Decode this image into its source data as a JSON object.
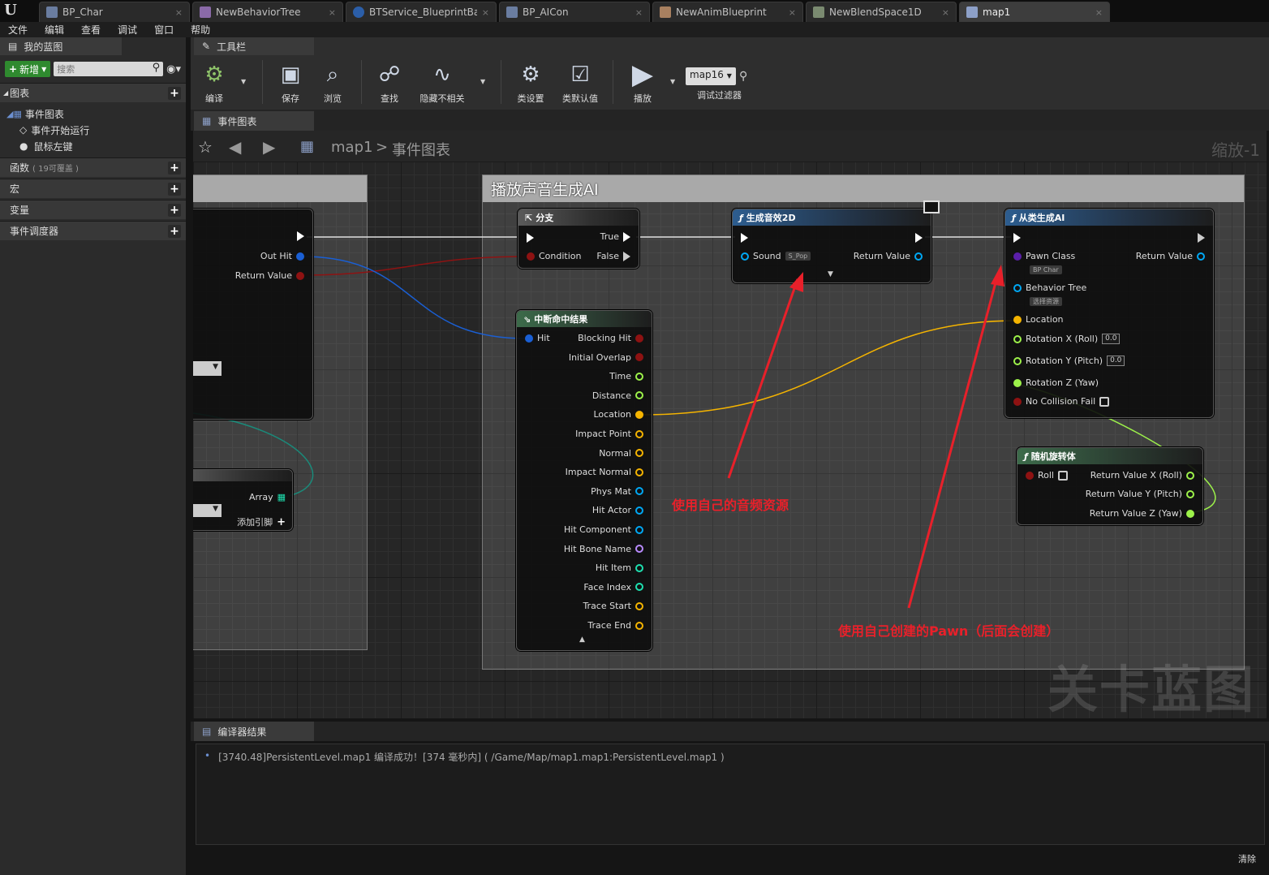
{
  "tabs": [
    {
      "label": "BP_Char",
      "active": false
    },
    {
      "label": "NewBehaviorTree",
      "active": false
    },
    {
      "label": "BTService_BlueprintBase_",
      "active": false
    },
    {
      "label": "BP_AICon",
      "active": false
    },
    {
      "label": "NewAnimBlueprint",
      "active": false
    },
    {
      "label": "NewBlendSpace1D",
      "active": false
    },
    {
      "label": "map1",
      "active": true
    }
  ],
  "menu": [
    "文件",
    "编辑",
    "查看",
    "调试",
    "窗口",
    "帮助"
  ],
  "left": {
    "title": "我的蓝图",
    "add_label": "新增",
    "search_placeholder": "搜索",
    "graphs_label": "图表",
    "event_graph": "事件图表",
    "event_begin": "事件开始运行",
    "mouse_left": "鼠标左键",
    "functions_label": "函数",
    "functions_sub": "( 19可覆盖 )",
    "macros_label": "宏",
    "variables_label": "变量",
    "dispatchers_label": "事件调度器"
  },
  "toolbar": {
    "title": "工具栏",
    "compile": "编译",
    "save": "保存",
    "browse": "浏览",
    "find": "查找",
    "hide_unrelated": "隐藏不相关",
    "class_settings": "类设置",
    "class_defaults": "类默认值",
    "play": "播放",
    "debug_select": "map16",
    "debug_filter": "调试过滤器"
  },
  "graph_tab": "事件图表",
  "breadcrumb": {
    "root": "map1",
    "sep": ">",
    "current": "事件图表",
    "zoom": "缩放-1"
  },
  "comment_title": "播放声音生成AI",
  "watermark": "关卡蓝图",
  "nodes": {
    "left": {
      "out_hit": "Out Hit",
      "return_value": "Return Value",
      "array": "Array",
      "add_pin": "添加引脚"
    },
    "branch": {
      "title": "分支",
      "true": "True",
      "condition": "Condition",
      "false": "False"
    },
    "sound": {
      "title": "生成音效2D",
      "sound": "Sound",
      "sound_val": "S_Pop",
      "return": "Return Value"
    },
    "break_hit": {
      "title": "中断命中结果",
      "hit": "Hit",
      "pins": [
        "Blocking Hit",
        "Initial Overlap",
        "Time",
        "Distance",
        "Location",
        "Impact Point",
        "Normal",
        "Impact Normal",
        "Phys Mat",
        "Hit Actor",
        "Hit Component",
        "Hit Bone Name",
        "Hit Item",
        "Face Index",
        "Trace Start",
        "Trace End"
      ]
    },
    "spawn_ai": {
      "title": "从类生成AI",
      "pawn_class": "Pawn Class",
      "pawn_val": "BP Char",
      "return": "Return Value",
      "behavior_tree": "Behavior Tree",
      "bt_val": "选择资源",
      "location": "Location",
      "rot_x": "Rotation X (Roll)",
      "rot_y": "Rotation Y (Pitch)",
      "rot_z": "Rotation Z (Yaw)",
      "rot_x_val": "0.0",
      "rot_y_val": "0.0",
      "no_collision": "No Collision Fail"
    },
    "random_rot": {
      "title": "随机旋转体",
      "roll": "Roll",
      "rx": "Return Value X (Roll)",
      "ry": "Return Value Y (Pitch)",
      "rz": "Return Value Z (Yaw)"
    }
  },
  "annotations": {
    "sound_note": "使用自己的音频资源",
    "pawn_note": "使用自己创建的Pawn（后面会创建）"
  },
  "compiler": {
    "tab": "编译器结果",
    "log": "[3740.48]PersistentLevel.map1 编译成功！[374 毫秒内] ( /Game/Map/map1.map1:PersistentLevel.map1 )",
    "clear": "清除"
  },
  "colors": {
    "exec": "#ffffff",
    "bool": "#8e1212",
    "struct": "#1a5fd4",
    "float": "#9df24a",
    "vector": "#f5b400",
    "object": "#00a8f4",
    "class": "#5b1faa",
    "name": "#b98bff",
    "int": "#1ee0b0",
    "annotation": "#e8202a"
  }
}
